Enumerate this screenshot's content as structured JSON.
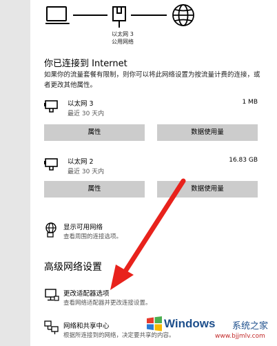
{
  "diagram": {
    "adapter_name": "以太网 3",
    "network_type": "公用网络"
  },
  "status": {
    "heading": "你已连接到 Internet",
    "description": "如果你的流量套餐有限制，则你可以将此网络设置为按流量计费的连接，或者更改其他属性。"
  },
  "adapters": [
    {
      "name": "以太网 3",
      "subtitle": "最近 30 天内",
      "usage": "1 MB",
      "btn_properties": "属性",
      "btn_data_usage": "数据使用量"
    },
    {
      "name": "以太网 2",
      "subtitle": "最近 30 天内",
      "usage": "16.83 GB",
      "btn_properties": "属性",
      "btn_data_usage": "数据使用量"
    }
  ],
  "show_networks": {
    "title": "显示可用网络",
    "subtitle": "查看周围的连接选项。"
  },
  "advanced": {
    "heading": "高级网络设置",
    "items": [
      {
        "title": "更改适配器选项",
        "subtitle": "查看网络适配器并更改连接设置。"
      },
      {
        "title": "网络和共享中心",
        "subtitle": "根据所连接到的网络，决定要共享的内容。"
      }
    ]
  },
  "watermark": {
    "brand": "Windows",
    "cn": "系统之家",
    "url": "www.bjjmlv.com"
  },
  "colors": {
    "button_bg": "#cccccc",
    "arrow": "#e8221c",
    "watermark_text": "#1d4f8c",
    "watermark_url": "#c22828"
  }
}
